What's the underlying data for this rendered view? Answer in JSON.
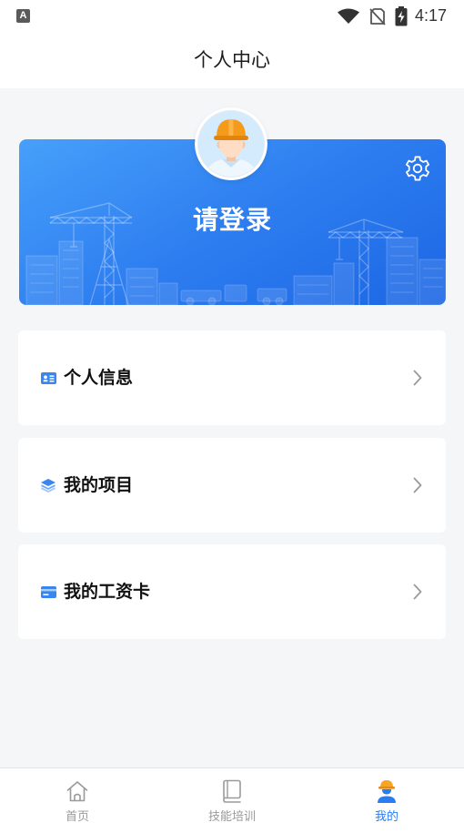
{
  "status_bar": {
    "notification_glyph": "A",
    "time": "4:17",
    "icons": [
      "wifi-icon",
      "no-sim-icon",
      "battery-charging-icon"
    ]
  },
  "header": {
    "title": "个人中心"
  },
  "profile_card": {
    "login_label": "请登录",
    "avatar_icon": "worker-avatar-icon",
    "settings_icon": "gear-icon"
  },
  "menu": [
    {
      "label": "个人信息",
      "icon": "id-card-icon",
      "trailing_icon": "chevron-right-icon"
    },
    {
      "label": "我的项目",
      "icon": "layers-icon",
      "trailing_icon": "chevron-right-icon"
    },
    {
      "label": "我的工资卡",
      "icon": "bank-card-icon",
      "trailing_icon": "chevron-right-icon"
    }
  ],
  "tab_bar": [
    {
      "label": "首页",
      "icon": "home-icon",
      "active": false
    },
    {
      "label": "技能培训",
      "icon": "book-icon",
      "active": false
    },
    {
      "label": "我的",
      "icon": "worker-user-icon",
      "active": true
    }
  ],
  "colors": {
    "accent": "#2b7cf2",
    "card_gradient_start": "#47a0fa",
    "card_gradient_end": "#1c66e4",
    "inactive": "#9a9a9a",
    "page_background": "#f5f6f8",
    "menu_icon": "#3a86f0",
    "helmet": "#f59b1b"
  }
}
